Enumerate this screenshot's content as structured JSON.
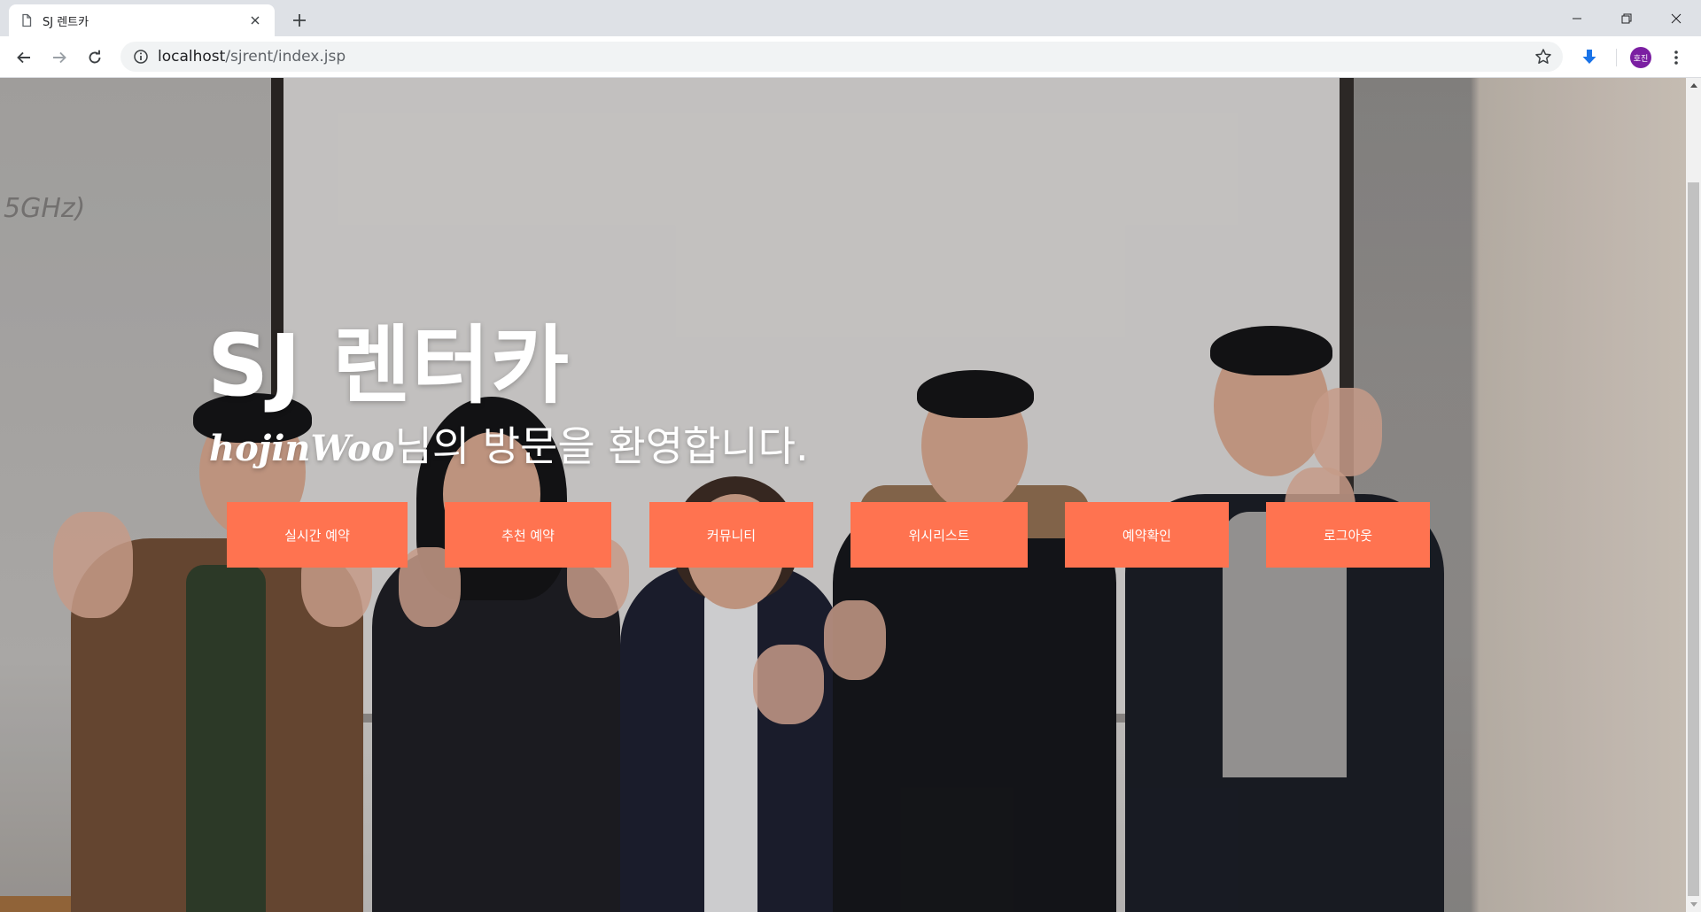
{
  "browser": {
    "tab_title": "SJ 렌트카",
    "url_host": "localhost",
    "url_path": "/sjrent/index.jsp",
    "profile_initials": "호진"
  },
  "hero": {
    "title": "SJ 렌터카",
    "username": "hojinWoo",
    "greeting": "님의 방문을 환영합니다.",
    "background_scribble": "5GHz)"
  },
  "menu": {
    "realtime_reservation": "실시간 예약",
    "recommended_reservation": "추천 예약",
    "community": "커뮤니티",
    "wishlist": "위시리스트",
    "reservation_check": "예약확인",
    "logout": "로그아웃"
  },
  "colors": {
    "button_bg": "#ff7350",
    "button_text": "#ffffff",
    "avatar_bg": "#7b1fa2",
    "download_icon": "#1a73e8"
  }
}
